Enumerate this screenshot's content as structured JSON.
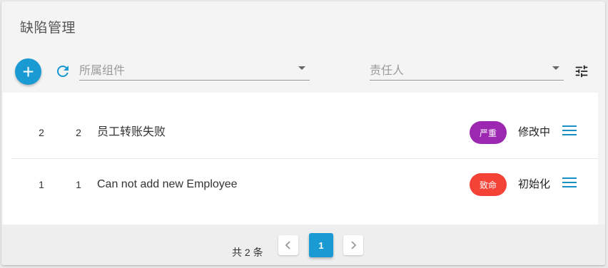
{
  "header": {
    "title": "缺陷管理"
  },
  "toolbar": {
    "component_select": {
      "placeholder": "所属组件"
    },
    "assignee_select": {
      "placeholder": "责任人"
    }
  },
  "defects": [
    {
      "col1": "2",
      "col2": "2",
      "title": "员工转账失败",
      "severity": "严重",
      "severity_color": "#9c27b0",
      "status": "修改中"
    },
    {
      "col1": "1",
      "col2": "1",
      "title": "Can not add new Employee",
      "severity": "致命",
      "severity_color": "#f44336",
      "status": "初始化"
    }
  ],
  "pagination": {
    "total_label": "共 2 条",
    "current_page": "1"
  },
  "colors": {
    "accent": "#1a9ad3"
  },
  "icons": [
    "add-icon",
    "refresh-icon",
    "caret-down-icon",
    "filter-icon",
    "menu-icon",
    "chevron-left-icon",
    "chevron-right-icon"
  ]
}
